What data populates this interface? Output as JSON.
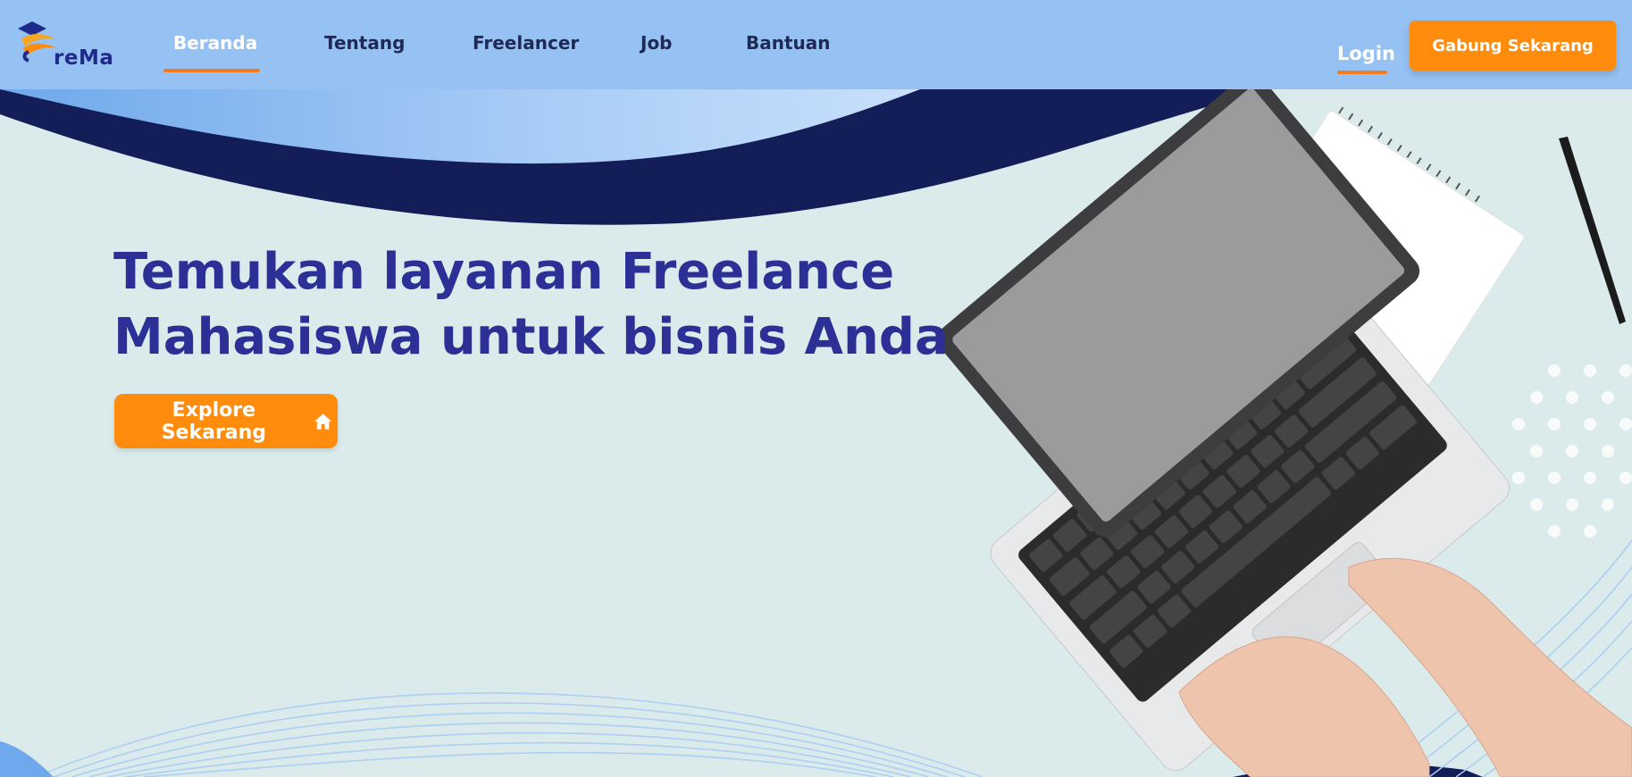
{
  "brand": {
    "logo_text": "reMa",
    "accent": "#ff8c0d",
    "nav_bg": "#95c1f3",
    "dark_wave": "#131d57"
  },
  "nav": {
    "items": [
      {
        "label": "Beranda",
        "active": true
      },
      {
        "label": "Tentang"
      },
      {
        "label": "Freelancer"
      },
      {
        "label": "Job"
      },
      {
        "label": "Bantuan"
      }
    ],
    "login_label": "Login",
    "join_label": "Gabung Sekarang"
  },
  "hero": {
    "headline_line1": "Temukan layanan Freelance",
    "headline_line2": "Mahasiswa untuk bisnis Anda",
    "cta_label": "Explore Sekarang",
    "cta_icon": "home-icon"
  }
}
